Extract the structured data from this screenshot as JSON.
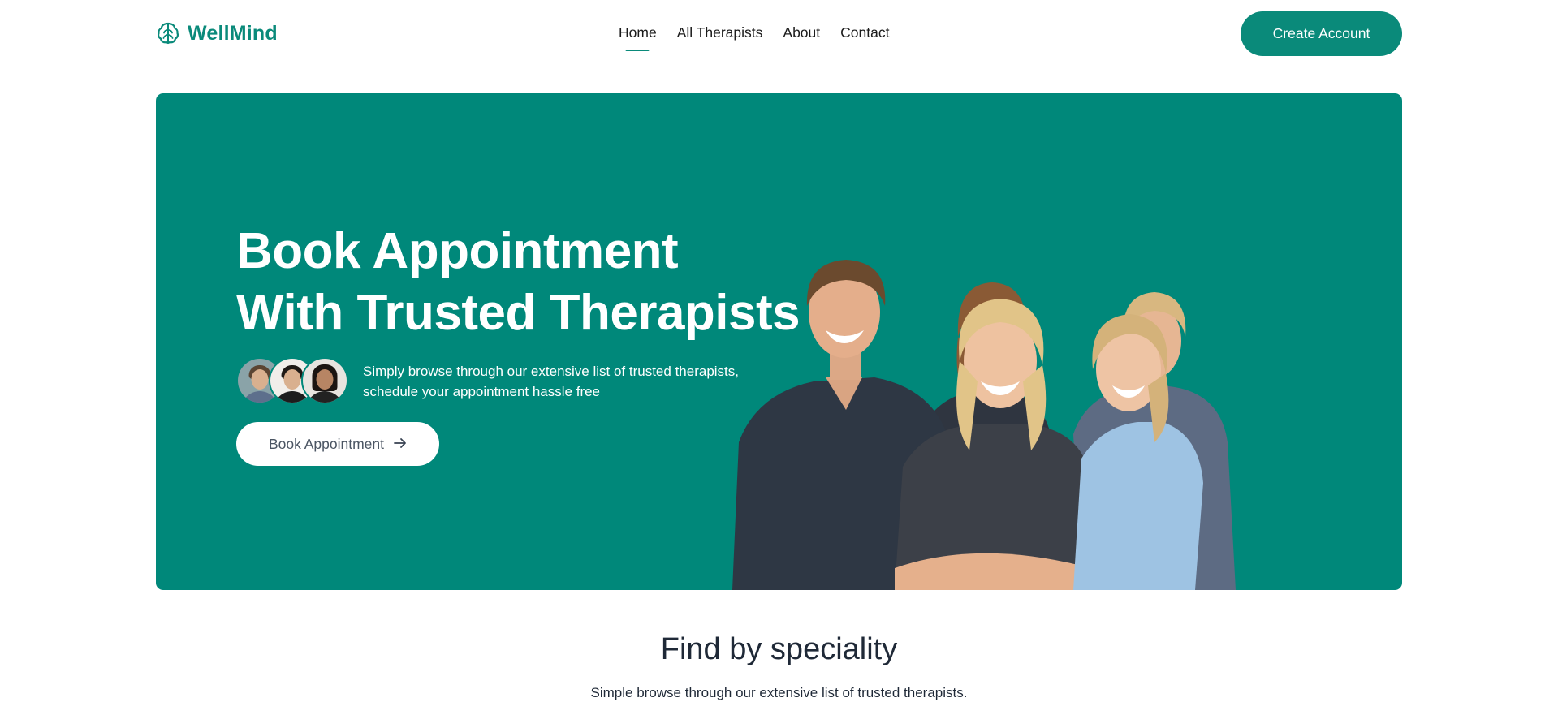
{
  "brand": {
    "name": "WellMind",
    "color": "#0a8a7a",
    "icon": "brain-icon"
  },
  "nav": {
    "items": [
      {
        "label": "Home",
        "active": true
      },
      {
        "label": "All Therapists",
        "active": false
      },
      {
        "label": "About",
        "active": false
      },
      {
        "label": "Contact",
        "active": false
      }
    ],
    "cta_label": "Create Account"
  },
  "hero": {
    "background": "#00887a",
    "title_line1": "Book Appointment",
    "title_line2": "With Trusted Therapists",
    "description_line1": "Simply browse through our extensive list of trusted therapists,",
    "description_line2": "schedule your appointment hassle free",
    "button_label": "Book Appointment",
    "button_icon": "arrow-right-icon",
    "avatar_count": 3,
    "photo": "group-of-therapists-photo"
  },
  "speciality": {
    "title": "Find by speciality",
    "subtitle": "Simple browse through our extensive list of trusted therapists."
  }
}
